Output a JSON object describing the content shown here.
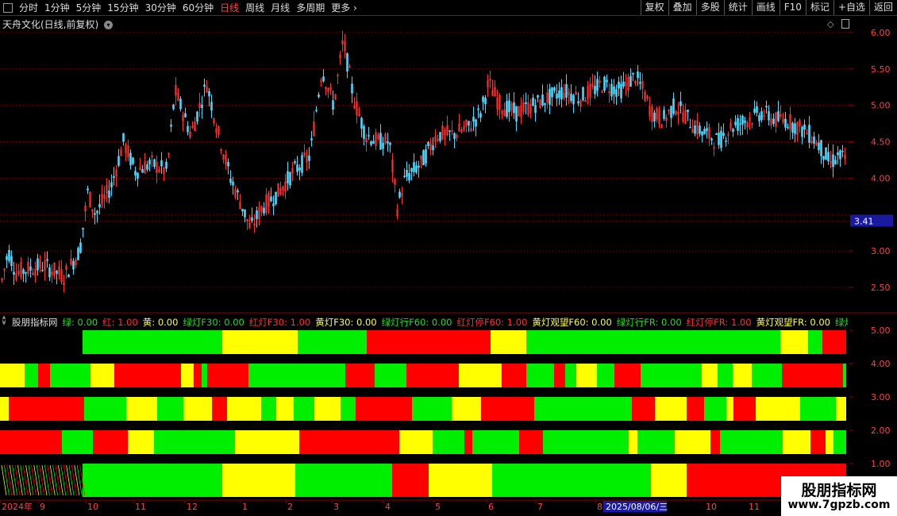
{
  "toolbar": {
    "periods": [
      "分时",
      "1分钟",
      "5分钟",
      "15分钟",
      "30分钟",
      "60分钟",
      "日线",
      "周线",
      "月线",
      "多周期",
      "更多"
    ],
    "active_period": "日线",
    "more_arrow": "›",
    "right_buttons": [
      "复权",
      "叠加",
      "多股",
      "统计",
      "画线",
      "F10",
      "标记",
      "+自选",
      "返回"
    ]
  },
  "chart": {
    "stock_title": "天舟文化(日线,前复权)",
    "price_axis": [
      "6.00",
      "5.50",
      "5.00",
      "4.50",
      "4.00",
      "3.00",
      "2.50"
    ],
    "current_price_label": "3.41",
    "indicator_axis": [
      "5.00",
      "4.00",
      "3.00",
      "2.00",
      "1.00"
    ]
  },
  "indicator": {
    "name": "股朋指标网",
    "values": [
      {
        "label": "绿: 0.00",
        "color": "#2bd62b"
      },
      {
        "label": "红: 1.00",
        "color": "#ff3030"
      },
      {
        "label": "黄: 0.00",
        "color": "#ffff40"
      },
      {
        "label": "绿灯F30: 0.00",
        "color": "#2bd62b"
      },
      {
        "label": "红灯F30: 1.00",
        "color": "#ff3030"
      },
      {
        "label": "黄灯F30: 0.00",
        "color": "#ffff40"
      },
      {
        "label": "绿灯行F60: 0.00",
        "color": "#2bd62b"
      },
      {
        "label": "红灯停F60: 1.00",
        "color": "#ff3030"
      },
      {
        "label": "黄灯观望F60: 0.00",
        "color": "#ffff40"
      },
      {
        "label": "绿灯行FR: 0.00",
        "color": "#2bd62b"
      },
      {
        "label": "红灯停FR: 1.00",
        "color": "#ff3030"
      },
      {
        "label": "黄灯观望FR: 0.00",
        "color": "#ffff40"
      },
      {
        "label": "绿灯行DF",
        "color": "#2bd62b"
      }
    ]
  },
  "time_axis": {
    "labels": [
      "2024年",
      "9",
      "10",
      "11",
      "12",
      "1",
      "2",
      "3",
      "4",
      "5",
      "6",
      "7",
      "8"
    ],
    "highlight_date": "2025/08/06/三",
    "labels_after": [
      "10",
      "11"
    ]
  },
  "watermark": {
    "title": "股朋指标网",
    "url": "www.7gpzb.com"
  },
  "colors": {
    "bg": "#000000",
    "up": "#ff3030",
    "down": "#4ad8ff",
    "green": "#00ee00",
    "red": "#ff0000",
    "yellow": "#ffff00",
    "grid": "#8b0000"
  }
}
